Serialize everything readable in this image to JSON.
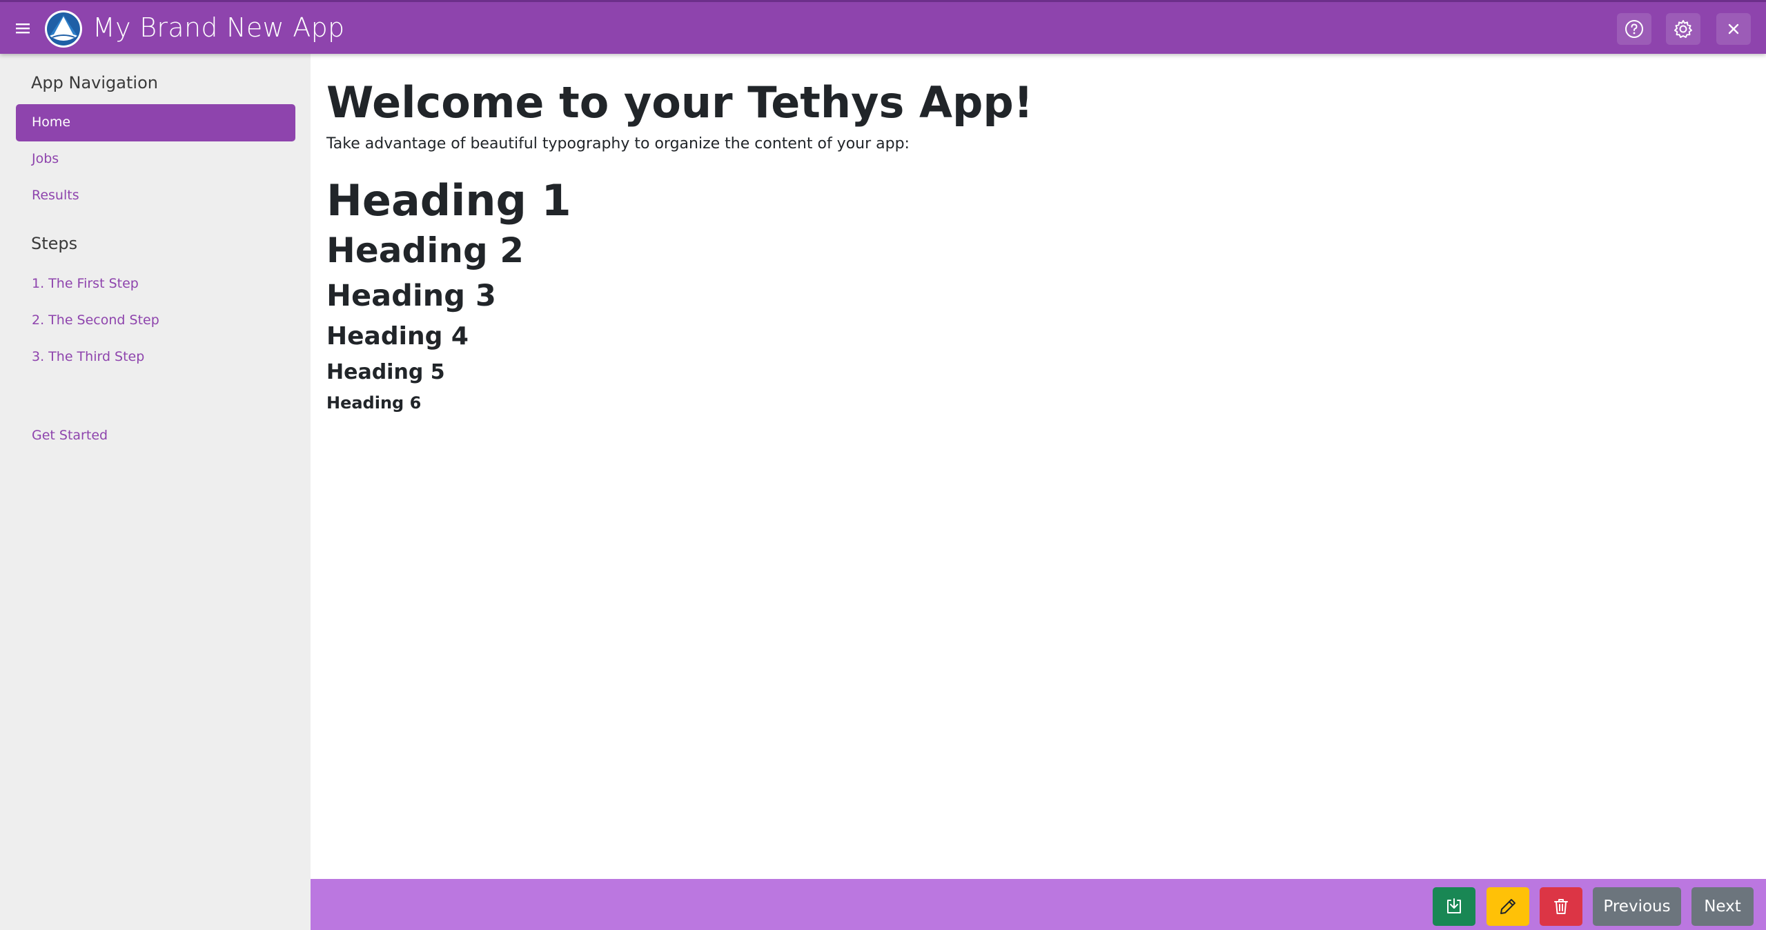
{
  "header": {
    "title": "My Brand New App",
    "icons": [
      "menu-icon",
      "app-logo",
      "help-icon",
      "settings-icon",
      "close-icon"
    ],
    "color": "#8e44ad"
  },
  "sidebar": {
    "nav_header": "App Navigation",
    "items": [
      {
        "label": "Home",
        "active": true
      },
      {
        "label": "Jobs"
      },
      {
        "label": "Results"
      }
    ],
    "steps_header": "Steps",
    "steps": [
      {
        "label": "1. The First Step"
      },
      {
        "label": "2. The Second Step"
      },
      {
        "label": "3. The Third Step"
      }
    ],
    "get_started": "Get Started",
    "background": "#eeeeee",
    "link_color": "#8e44ad"
  },
  "main": {
    "title": "Welcome to your Tethys App!",
    "lead": "Take advantage of beautiful typography to organize the content of your app:",
    "headings": [
      "Heading 1",
      "Heading 2",
      "Heading 3",
      "Heading 4",
      "Heading 5",
      "Heading 6"
    ]
  },
  "footer": {
    "background": "#bb77e0",
    "buttons": {
      "download_icon": "download-icon",
      "edit_icon": "pencil-icon",
      "delete_icon": "trash-icon",
      "previous": "Previous",
      "next": "Next"
    },
    "colors": {
      "success": "#198754",
      "warning": "#ffc107",
      "danger": "#dc3545",
      "secondary": "#6c757d"
    }
  }
}
